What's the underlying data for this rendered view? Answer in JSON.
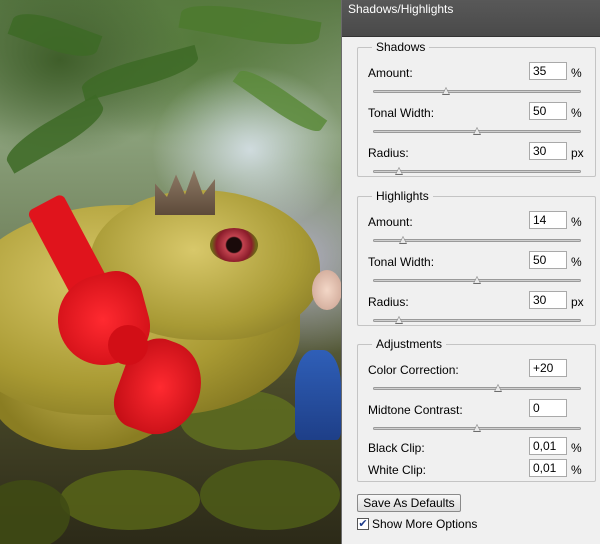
{
  "dialog": {
    "title": "Shadows/Highlights",
    "shadows": {
      "legend": "Shadows",
      "amount": {
        "label": "Amount:",
        "value": "35",
        "unit": "%",
        "slider": 0.35
      },
      "tonal": {
        "label": "Tonal Width:",
        "value": "50",
        "unit": "%",
        "slider": 0.5
      },
      "radius": {
        "label": "Radius:",
        "value": "30",
        "unit": "px",
        "slider": 0.12
      }
    },
    "highlights": {
      "legend": "Highlights",
      "amount": {
        "label": "Amount:",
        "value": "14",
        "unit": "%",
        "slider": 0.14
      },
      "tonal": {
        "label": "Tonal Width:",
        "value": "50",
        "unit": "%",
        "slider": 0.5
      },
      "radius": {
        "label": "Radius:",
        "value": "30",
        "unit": "px",
        "slider": 0.12
      }
    },
    "adjustments": {
      "legend": "Adjustments",
      "color_correction": {
        "label": "Color Correction:",
        "value": "+20",
        "slider": 0.6
      },
      "midtone_contrast": {
        "label": "Midtone Contrast:",
        "value": "0",
        "slider": 0.5
      },
      "black_clip": {
        "label": "Black Clip:",
        "value": "0,01",
        "unit": "%"
      },
      "white_clip": {
        "label": "White Clip:",
        "value": "0,01",
        "unit": "%"
      }
    },
    "save_defaults_label": "Save As Defaults",
    "show_more_options": {
      "label": "Show More Options",
      "checked": true
    }
  }
}
